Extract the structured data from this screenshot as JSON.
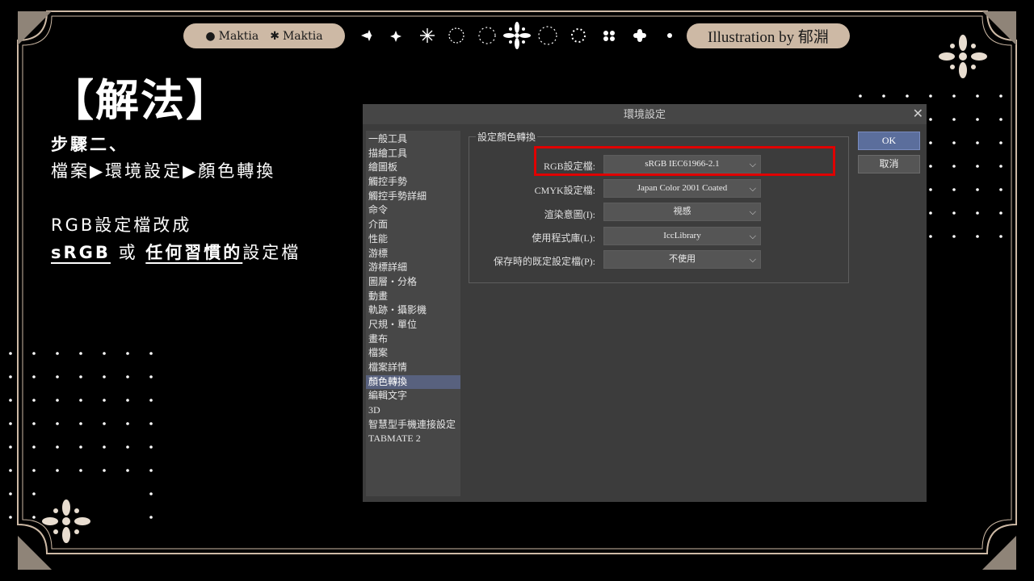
{
  "header": {
    "brand_left_1": "Maktia",
    "brand_right_1": "Maktia",
    "credit": "Illustration by 郁淵"
  },
  "slide": {
    "title": "【解法】",
    "step_heading": "步驟二、",
    "step_path": "檔案▶環境設定▶顏色轉換",
    "note_line1": "RGB設定檔改成",
    "note_srgb": "sRGB",
    "note_or": " 或 ",
    "note_any": "任何習慣的",
    "note_tail": "設定檔"
  },
  "dialog": {
    "title": "環境設定",
    "categories": [
      "一般工具",
      "描繪工具",
      "繪圖板",
      "觸控手勢",
      "觸控手勢詳細",
      "命令",
      "介面",
      "性能",
      "游標",
      "游標詳細",
      "圖層・分格",
      "動畫",
      "軌跡・攝影機",
      "尺規・單位",
      "畫布",
      "檔案",
      "檔案詳情",
      "顏色轉換",
      "編輯文字",
      "3D",
      "智慧型手機連接設定",
      "TABMATE 2"
    ],
    "selected_category": "顏色轉換",
    "group_label": "設定顏色轉換",
    "rows": [
      {
        "label": "RGB設定檔:",
        "value": "sRGB IEC61966-2.1"
      },
      {
        "label": "CMYK設定檔:",
        "value": "Japan Color 2001 Coated"
      },
      {
        "label": "渲染意圖(I):",
        "value": "視感"
      },
      {
        "label": "使用程式庫(L):",
        "value": "IccLibrary"
      },
      {
        "label": "保存時的既定設定檔(P):",
        "value": "不使用"
      }
    ],
    "ok_label": "OK",
    "cancel_label": "取消"
  }
}
